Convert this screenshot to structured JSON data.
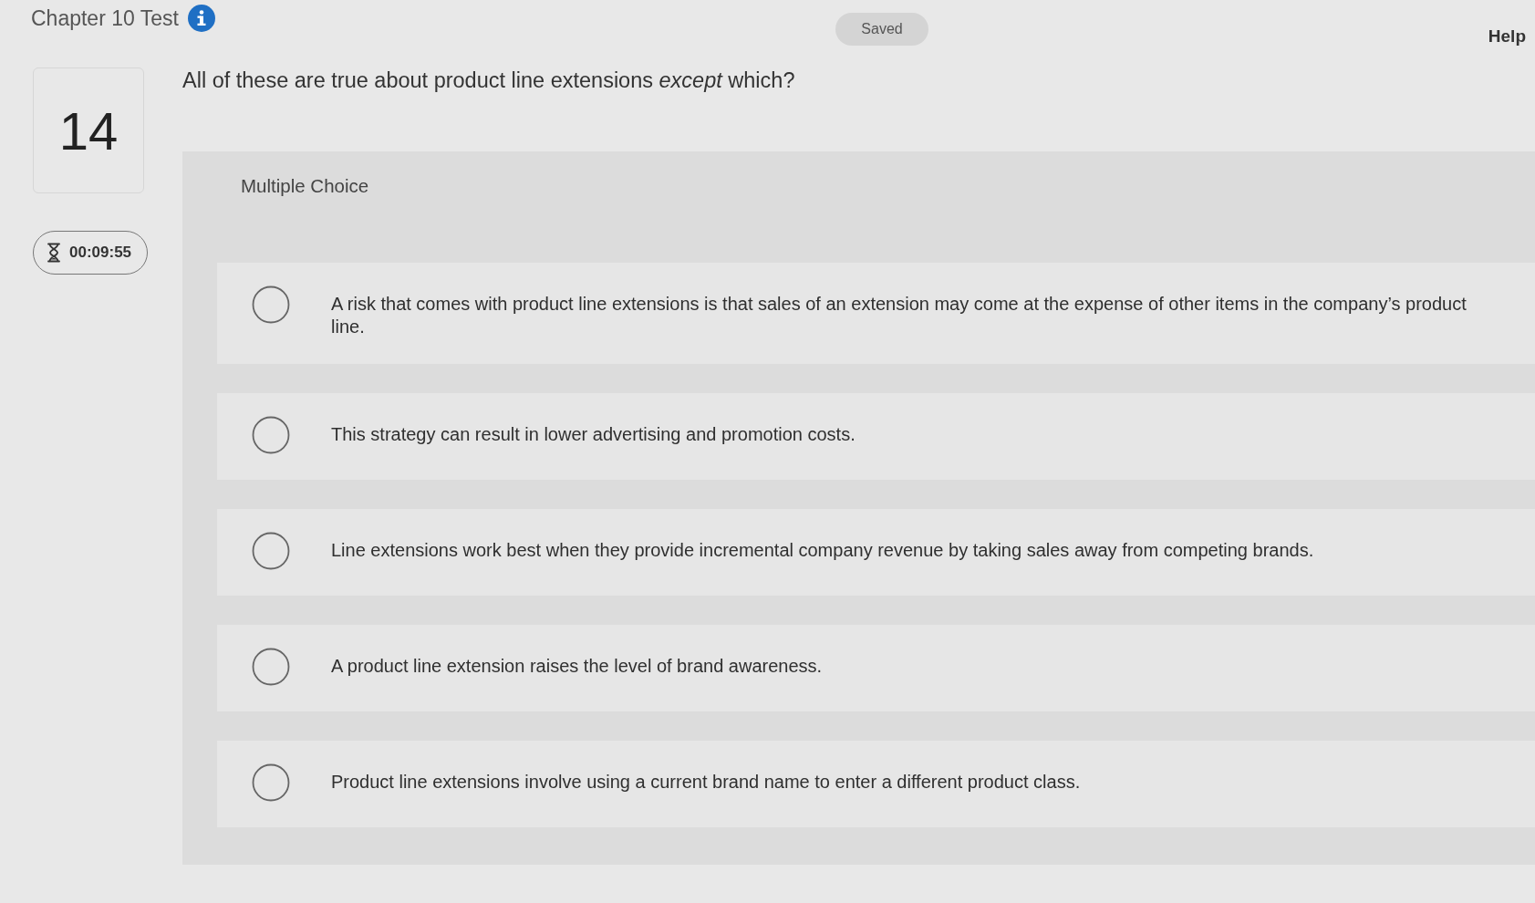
{
  "header": {
    "title": "Chapter 10 Test",
    "status": "Saved",
    "help": "Help"
  },
  "question": {
    "number": "14",
    "timer": "00:09:55",
    "prompt": "All of these are true about product line extensions *except* which?",
    "type": "Multiple Choice",
    "options": [
      {
        "text": "A risk that comes with product line extensions is that sales of an extension may come at the expense of other items in the company’s product line.",
        "selected": false
      },
      {
        "text": "This strategy can result in lower advertising and promotion costs.",
        "selected": false
      },
      {
        "text": "Line extensions work best when they provide incremental company revenue by taking sales away from competing brands.",
        "selected": false
      },
      {
        "text": "A product line extension raises the level of brand awareness.",
        "selected": false
      },
      {
        "text": "Product line extensions involve using a current brand name to enter a different product class.",
        "selected": false
      }
    ]
  }
}
